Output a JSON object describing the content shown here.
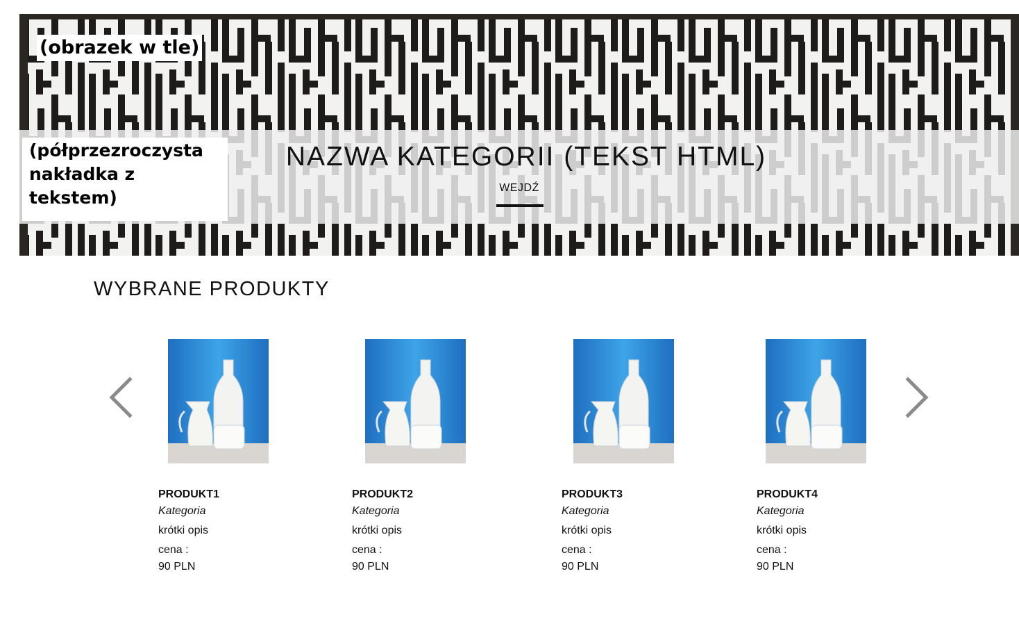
{
  "hero": {
    "background_caption": "(obrazek w tle)",
    "overlay_caption_lines": [
      "(półprzezroczysta",
      "nakładka z",
      "tekstem)"
    ],
    "category_title": "NAZWA KATEGORII (TEKST HTML)",
    "enter_link": "WEJDŹ"
  },
  "featured": {
    "title": "WYBRANE PRODUKTY",
    "prev_icon": "chevron-left-icon",
    "next_icon": "chevron-right-icon",
    "products": [
      {
        "name": "PRODUKT1",
        "category": "Kategoria",
        "description": "krótki opis",
        "price_label": "cena :",
        "price": "90 PLN"
      },
      {
        "name": "PRODUKT2",
        "category": "Kategoria",
        "description": "krótki opis",
        "price_label": "cena :",
        "price": "90 PLN"
      },
      {
        "name": "PRODUKT3",
        "category": "Kategoria",
        "description": "krótki opis",
        "price_label": "cena :",
        "price": "90 PLN"
      },
      {
        "name": "PRODUKT4",
        "category": "Kategoria",
        "description": "krótki opis",
        "price_label": "cena :",
        "price": "90 PLN"
      }
    ]
  },
  "colors": {
    "text": "#111111",
    "arrow": "#8a8a8a",
    "photo_sky": "#2f8fd6",
    "hero_dark": "#1e1c1a",
    "hero_light": "#f2f2f0"
  }
}
